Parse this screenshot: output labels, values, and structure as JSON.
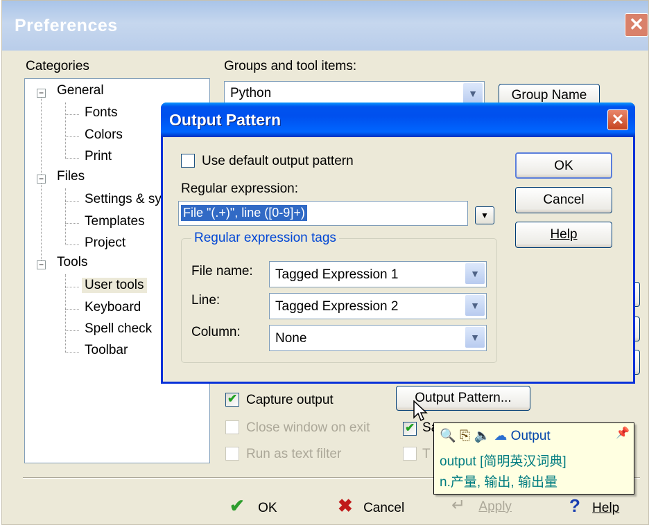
{
  "prefs": {
    "title": "Preferences",
    "categories_label": "Categories",
    "groups_label": "Groups and tool items:",
    "groups_value": "Python",
    "group_name_button": "Group Name",
    "tree": [
      {
        "label": "General",
        "level": 0,
        "expanded": true
      },
      {
        "label": "Fonts",
        "level": 1
      },
      {
        "label": "Colors",
        "level": 1
      },
      {
        "label": "Print",
        "level": 1
      },
      {
        "label": "Files",
        "level": 0,
        "expanded": true
      },
      {
        "label": "Settings & sy",
        "level": 1
      },
      {
        "label": "Templates",
        "level": 1
      },
      {
        "label": "Project",
        "level": 1
      },
      {
        "label": "Tools",
        "level": 0,
        "expanded": true
      },
      {
        "label": "User tools",
        "level": 1,
        "selected": true
      },
      {
        "label": "Keyboard",
        "level": 1
      },
      {
        "label": "Spell check",
        "level": 1
      },
      {
        "label": "Toolbar",
        "level": 1
      }
    ],
    "capture_output": "Capture output",
    "close_window": "Close window on exit",
    "run_as_filter": "Run as text filter",
    "save_partial": "Sa",
    "text_partial": "T",
    "output_pattern_button": "Output Pattern...",
    "ok": "OK",
    "cancel": "Cancel",
    "apply": "Apply",
    "help": "Help"
  },
  "dialog": {
    "title": "Output Pattern",
    "use_default": "Use default output pattern",
    "regex_label": "Regular expression:",
    "regex_value": "File \"(.+)\", line ([0-9]+)",
    "tags_legend": "Regular expression tags",
    "file_name_label": "File name:",
    "file_name_value": "Tagged Expression 1",
    "line_label": "Line:",
    "line_value": "Tagged Expression 2",
    "column_label": "Column:",
    "column_value": "None",
    "ok": "OK",
    "cancel": "Cancel",
    "help": "Help"
  },
  "dict": {
    "word": "Output",
    "line2": "output [简明英汉词典]",
    "line3": "n.产量, 输出, 输出量"
  },
  "colors": {
    "dialog_titlebar": "#0053ee",
    "selection": "#316ac5",
    "dict_text": "#007c80"
  }
}
